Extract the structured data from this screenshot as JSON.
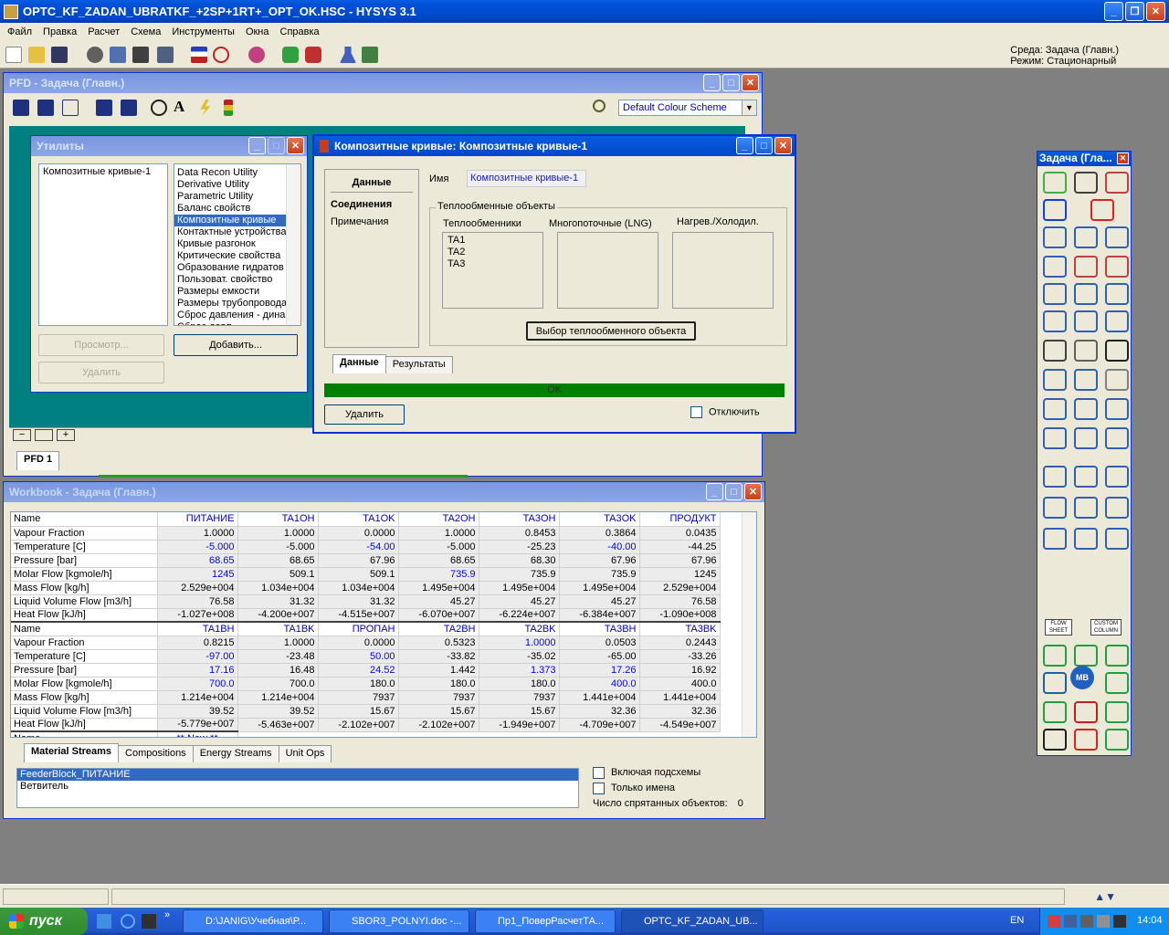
{
  "app": {
    "title": "OPTC_KF_ZADAN_UBRATKF_+2SP+1RT+_OPT_OK.HSC - HYSYS 3.1",
    "menu": [
      "Файл",
      "Правка",
      "Расчет",
      "Схема",
      "Инструменты",
      "Окна",
      "Справка"
    ],
    "env_line1": "Среда: Задача (Главн.)",
    "env_line2": "Режим: Стационарный"
  },
  "pfd": {
    "title": "PFD - Задача (Главн.)",
    "colour_scheme": "Default Colour Scheme",
    "tab": "PFD 1"
  },
  "utilities": {
    "title": "Утилиты",
    "existing": [
      "Композитные кривые-1"
    ],
    "available": [
      "Data Recon Utility",
      "Derivative Utility",
      "Parametric Utility",
      "Баланс свойств",
      "Композитные кривые",
      "Контактные устройства",
      "Кривые разгонок",
      "Критические свойства",
      "Образование гидратов",
      "Пользоват. свойство",
      "Размеры емкости",
      "Размеры трубопровода",
      "Сброс давления - динам",
      "Сброс давл."
    ],
    "selected_index": 4,
    "view_btn": "Просмотр...",
    "add_btn": "Добавить...",
    "delete_btn": "Удалить"
  },
  "composite": {
    "title": "Композитные кривые: Композитные кривые-1",
    "nav": [
      "Данные",
      "Соединения",
      "Примечания"
    ],
    "name_label": "Имя",
    "name_value": "Композитные кривые-1",
    "group_title": "Теплообменные объекты",
    "col1": "Теплообменники",
    "col2": "Многопоточные (LNG)",
    "col3": "Нагрев./Холодил.",
    "exchangers": [
      "TA1",
      "TA2",
      "TA3"
    ],
    "select_btn": "Выбор теплообменного объекта",
    "tabs": [
      "Данные",
      "Результаты"
    ],
    "status": "OK",
    "delete_btn": "Удалить",
    "disable_label": "Отключить"
  },
  "workbook": {
    "title": "Workbook - Задача (Главн.)",
    "block1": {
      "columns": [
        "ПИТАНИЕ",
        "TA1OH",
        "TA1OK",
        "TA2OH",
        "TA3OH",
        "TA3OK",
        "ПРОДУКТ"
      ],
      "rows": [
        {
          "label": "Vapour Fraction",
          "values": [
            "1.0000",
            "1.0000",
            "0.0000",
            "1.0000",
            "0.8453",
            "0.3864",
            "0.0435"
          ],
          "blue": []
        },
        {
          "label": "Temperature [C]",
          "values": [
            "-5.000",
            "-5.000",
            "-54.00",
            "-5.000",
            "-25.23",
            "-40.00",
            "-44.25"
          ],
          "blue": [
            0,
            2,
            5
          ]
        },
        {
          "label": "Pressure [bar]",
          "values": [
            "68.65",
            "68.65",
            "67.96",
            "68.65",
            "68.30",
            "67.96",
            "67.96"
          ],
          "blue": [
            0
          ]
        },
        {
          "label": "Molar Flow [kgmole/h]",
          "values": [
            "1245",
            "509.1",
            "509.1",
            "735.9",
            "735.9",
            "735.9",
            "1245"
          ],
          "blue": [
            0,
            3
          ]
        },
        {
          "label": "Mass Flow [kg/h]",
          "values": [
            "2.529e+004",
            "1.034e+004",
            "1.034e+004",
            "1.495e+004",
            "1.495e+004",
            "1.495e+004",
            "2.529e+004"
          ],
          "blue": []
        },
        {
          "label": "Liquid Volume Flow [m3/h]",
          "values": [
            "76.58",
            "31.32",
            "31.32",
            "45.27",
            "45.27",
            "45.27",
            "76.58"
          ],
          "blue": []
        },
        {
          "label": "Heat Flow [kJ/h]",
          "values": [
            "-1.027e+008",
            "-4.200e+007",
            "-4.515e+007",
            "-6.070e+007",
            "-6.224e+007",
            "-6.384e+007",
            "-1.090e+008"
          ],
          "blue": []
        }
      ]
    },
    "block2": {
      "columns": [
        "TA1BH",
        "TA1BK",
        "ПРОПАН",
        "TA2BH",
        "TA2BK",
        "TA3BH",
        "TA3BK"
      ],
      "rows": [
        {
          "label": "Vapour Fraction",
          "values": [
            "0.8215",
            "1.0000",
            "0.0000",
            "0.5323",
            "1.0000",
            "0.0503",
            "0.2443"
          ],
          "blue": [
            4
          ]
        },
        {
          "label": "Temperature [C]",
          "values": [
            "-97.00",
            "-23.48",
            "50.00",
            "-33.82",
            "-35.02",
            "-65.00",
            "-33.26"
          ],
          "blue": [
            0,
            2
          ]
        },
        {
          "label": "Pressure [bar]",
          "values": [
            "17.16",
            "16.48",
            "24.52",
            "1.442",
            "1.373",
            "17.26",
            "16.92"
          ],
          "blue": [
            0,
            2,
            4,
            5
          ]
        },
        {
          "label": "Molar Flow [kgmole/h]",
          "values": [
            "700.0",
            "700.0",
            "180.0",
            "180.0",
            "180.0",
            "400.0",
            "400.0"
          ],
          "blue": [
            0,
            5
          ]
        },
        {
          "label": "Mass Flow [kg/h]",
          "values": [
            "1.214e+004",
            "1.214e+004",
            "7937",
            "7937",
            "7937",
            "1.441e+004",
            "1.441e+004"
          ],
          "blue": []
        },
        {
          "label": "Liquid Volume Flow [m3/h]",
          "values": [
            "39.52",
            "39.52",
            "15.67",
            "15.67",
            "15.67",
            "32.36",
            "32.36"
          ],
          "blue": []
        },
        {
          "label": "Heat Flow [kJ/h]",
          "values": [
            "-5.779e+007",
            "-5.463e+007",
            "-2.102e+007",
            "-2.102e+007",
            "-1.949e+007",
            "-4.709e+007",
            "-4.549e+007"
          ],
          "blue": []
        }
      ]
    },
    "name_label": "Name",
    "new_cell": "** New **",
    "tabs": [
      "Material Streams",
      "Compositions",
      "Energy Streams",
      "Unit Ops"
    ],
    "ops": [
      "FeederBlock_ПИТАНИЕ",
      "Ветвитель"
    ],
    "include_sub": "Включая подсхемы",
    "names_only": "Только имена",
    "hidden_label": "Число спрятанных объектов:",
    "hidden_count": "0"
  },
  "palette": {
    "title": "Задача (Гла...",
    "flowsheet_btn": "FLOW SHEET",
    "column_btn": "CUSTOM COLUMN",
    "mb_label": "MB"
  },
  "taskbar": {
    "start": "пуск",
    "tasks": [
      "D:\\JANIG\\Учебная\\Р...",
      "SBOR3_POLNYI.doc -...",
      "Пр1_ПоверРасчетТА...",
      "OPTC_KF_ZADAN_UB..."
    ],
    "lang": "EN",
    "clock": "14:04"
  }
}
